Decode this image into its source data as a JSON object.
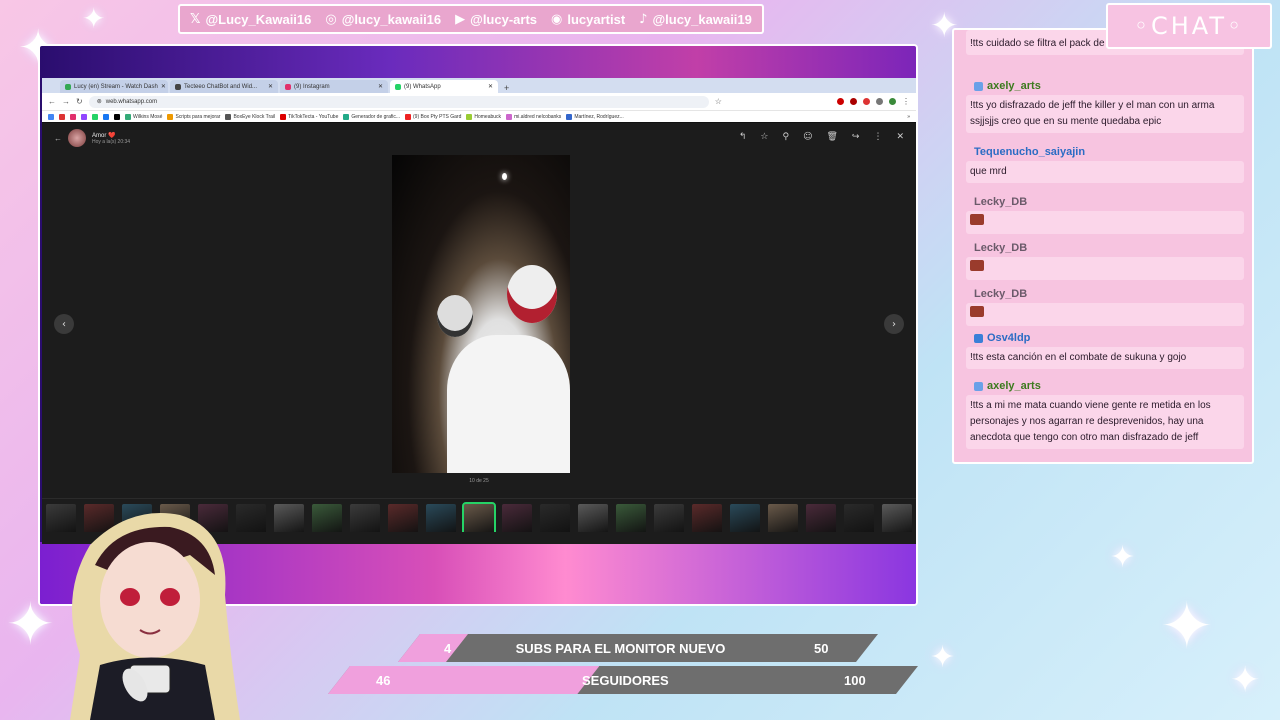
{
  "socials": [
    {
      "icon": "x-icon",
      "glyph": "𝕏",
      "handle": "@Lucy_Kawaii16"
    },
    {
      "icon": "instagram-icon",
      "glyph": "◎",
      "handle": "@lucy_kawaii16"
    },
    {
      "icon": "youtube-icon",
      "glyph": "▶",
      "handle": "@lucy-arts"
    },
    {
      "icon": "discord-icon",
      "glyph": "◉",
      "handle": "lucyartist"
    },
    {
      "icon": "tiktok-icon",
      "glyph": "♪",
      "handle": "@lucy_kawaii19"
    }
  ],
  "browser": {
    "tabs": [
      {
        "label": "Lucy (en) Stream - Watch Dash",
        "color": "#34a853",
        "active": false
      },
      {
        "label": "Tecteeo ChatBot and Wid...",
        "color": "#444444",
        "active": false
      },
      {
        "label": "(9) Instagram",
        "color": "#e1306c",
        "active": false
      },
      {
        "label": "(9) WhatsApp",
        "color": "#25d366",
        "active": true
      }
    ],
    "url": "web.whatsapp.com",
    "bookmarks": [
      "Wilkins Mosé",
      "Scripts para mejorar",
      "BoxEye Klock Trail",
      "TikTokTecta - YouTube",
      "Generador de grafic...",
      "(9) Box Pty PTS Gard",
      "Homeabuck",
      "mi.aldred nelcobanks",
      "Martínez, Rodríguez..."
    ]
  },
  "viewer": {
    "contact_name": "Amor ❤️",
    "contact_time": "Hoy a la(s) 20:34",
    "counter": "10 de 25",
    "thumb_count": 23,
    "selected_thumb": 11
  },
  "chat": {
    "title": "◦CHAT◦",
    "messages": [
      {
        "user": "",
        "color": "#2a1a2a",
        "badge": "",
        "text": "!tts cuidado se filtra el pack de axely que rico"
      },
      {
        "user": "axely_arts",
        "color": "#3c7a1e",
        "badge": "#6aa0e8",
        "text": "!tts yo disfrazado de jeff the killer y el man con un arma ssjjsjjs creo que en su mente quedaba epic"
      },
      {
        "user": "Tequenucho_saiyajin",
        "color": "#2b6cc4",
        "badge": "",
        "text": "que mrd"
      },
      {
        "user": "Lecky_DB",
        "color": "#6b5a6a",
        "badge": "",
        "text": ""
      },
      {
        "user": "Lecky_DB",
        "color": "#6b5a6a",
        "badge": "",
        "text": ""
      },
      {
        "user": "Lecky_DB",
        "color": "#6b5a6a",
        "badge": "",
        "text": ""
      },
      {
        "user": "Osv4ldp",
        "color": "#2b6cc4",
        "badge": "#3a7fd8",
        "text": "!tts esta canción en el combate de sukuna y gojo"
      },
      {
        "user": "axely_arts",
        "color": "#3c7a1e",
        "badge": "#6aa0e8",
        "text": "!tts a mi me mata cuando viene gente re metida en los personajes y nos agarran re desprevenidos, hay una anecdota que tengo con otro man disfrazado de jeff"
      }
    ]
  },
  "goals": [
    {
      "label": "SUBS PARA EL MONITOR NUEVO",
      "current": "4",
      "target": "50",
      "progress": 0.08
    },
    {
      "label": "SEGUIDORES",
      "current": "46",
      "target": "100",
      "progress": 0.46
    }
  ]
}
